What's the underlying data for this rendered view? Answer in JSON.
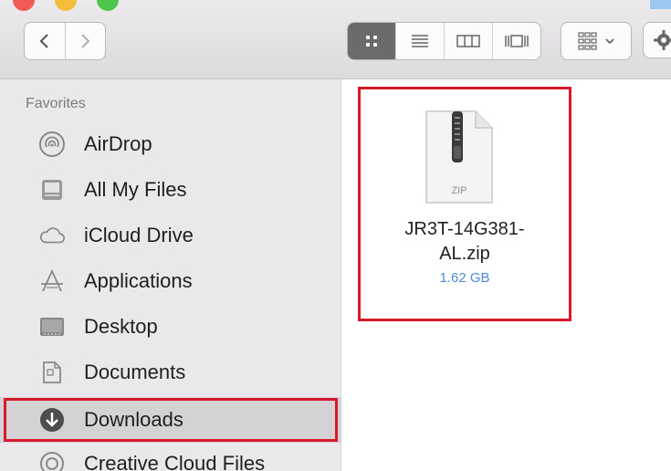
{
  "toolbar": {
    "back_icon": "chevron-left-icon",
    "forward_icon": "chevron-right-icon",
    "view_modes": [
      "icon-view",
      "list-view",
      "column-view",
      "cover-flow-view"
    ],
    "active_view": "icon-view",
    "arrange_icon": "arrange-grid-icon",
    "action_icon": "gear-icon"
  },
  "sidebar": {
    "heading": "Favorites",
    "items": [
      {
        "label": "AirDrop",
        "icon": "airdrop-icon"
      },
      {
        "label": "All My Files",
        "icon": "all-files-icon"
      },
      {
        "label": "iCloud Drive",
        "icon": "cloud-icon"
      },
      {
        "label": "Applications",
        "icon": "applications-icon"
      },
      {
        "label": "Desktop",
        "icon": "desktop-icon"
      },
      {
        "label": "Documents",
        "icon": "documents-icon"
      },
      {
        "label": "Downloads",
        "icon": "downloads-icon",
        "selected": true
      },
      {
        "label": "Creative Cloud Files",
        "icon": "creative-cloud-icon"
      }
    ]
  },
  "content": {
    "file": {
      "icon_label": "ZIP",
      "name_line1": "JR3T-14G381-",
      "name_line2": "AL.zip",
      "size": "1.62 GB",
      "icon": "zip-file-icon"
    }
  },
  "colors": {
    "highlight": "#d7192c",
    "size_text": "#4d8ad8",
    "sidebar_bg": "#eae8ea"
  }
}
